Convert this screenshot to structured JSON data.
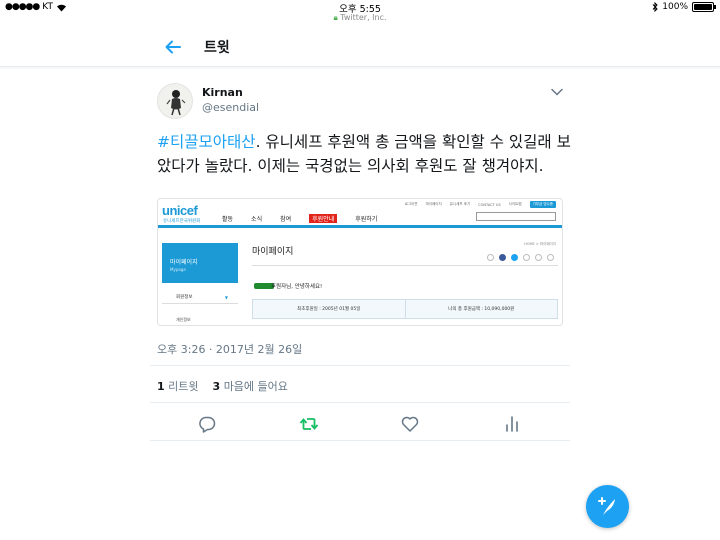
{
  "status_bar": {
    "carrier": "KT",
    "time": "오후 5:55",
    "url": "Twitter, Inc.",
    "battery": "100%"
  },
  "nav": {
    "title": "트윗"
  },
  "tweet": {
    "author_name": "Kirnan",
    "author_handle": "@esendial",
    "hashtag": "#티끌모아태산",
    "text_rest": ". 유니세프 후원액 총 금액을 확인할 수 있길래 보았다가 놀랐다. 이제는 국경없는 의사회 후원도 잘 챙겨야지.",
    "timestamp": "오후 3:26 · 2017년 2월 26일",
    "retweet_count": "1",
    "retweet_label": "리트윗",
    "like_count": "3",
    "like_label": "마음에 들어요"
  },
  "embed": {
    "logo": "unicef",
    "logo_sub": "유니세프한국위원회",
    "top_links": [
      "로그아웃",
      "마이페이지",
      "유니세프 후기",
      "CONTACT US",
      "사이트맵"
    ],
    "join_label": "기부금 영수증",
    "nav_items": [
      "활동",
      "소식",
      "참여",
      "후원안내",
      "후원하기"
    ],
    "side_title": "마이페이지",
    "side_sub": "Mypage",
    "side_item1": "회원정보",
    "side_item2": "개인정보",
    "page_title": "마이페이지",
    "breadcrumb": "HOME > 마이페이지",
    "greeting": "후원자님, 안녕하세요!",
    "first_donation": "최초후원일 : 2005년 01월 05일",
    "total_donation": "나의 총 후원금액 : 10,090,000원"
  },
  "colors": {
    "twitter_blue": "#1da1f2",
    "retweet_green": "#17bf63",
    "unicef_blue": "#1c9ad6"
  },
  "icons": [
    "back-arrow-icon",
    "chevron-down-icon",
    "reply-icon",
    "retweet-icon",
    "like-icon",
    "analytics-icon",
    "compose-icon",
    "wifi-icon",
    "bluetooth-icon",
    "lock-icon"
  ]
}
